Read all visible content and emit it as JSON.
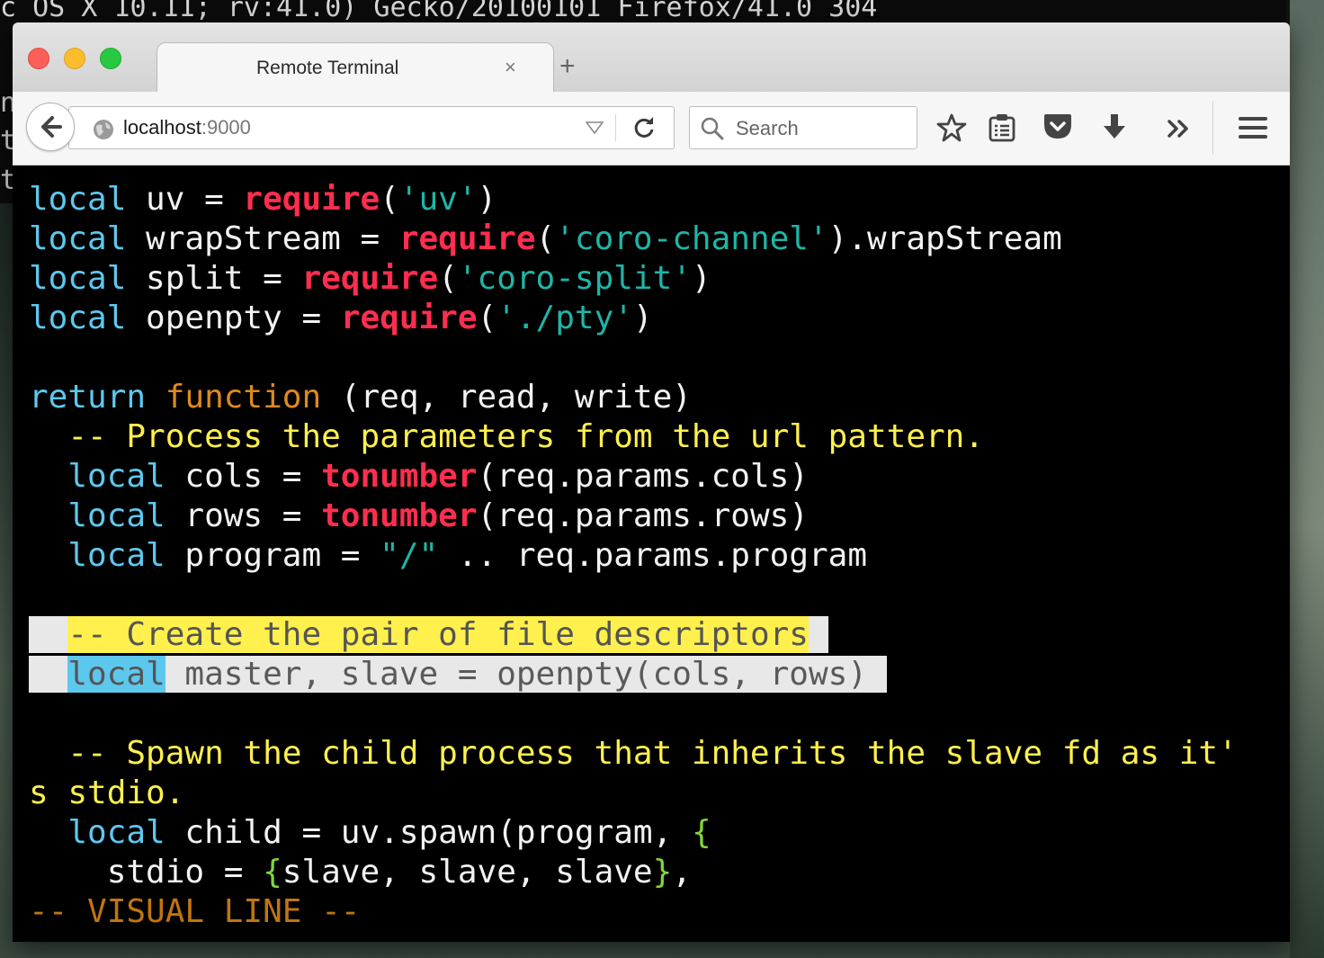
{
  "desktop": {
    "top_text": "c OS X 10.11; rv:41.0) Gecko/20100101 Firefox/41.0 304",
    "left_chars": [
      "n",
      "t",
      "t"
    ]
  },
  "tab": {
    "title": "Remote Terminal",
    "close_glyph": "×",
    "new_tab_glyph": "+"
  },
  "url": {
    "host": "localhost",
    "port": ":9000"
  },
  "search": {
    "placeholder": "Search"
  },
  "toolbar_icons": [
    "back-icon",
    "globe-icon",
    "dropdown-icon",
    "reload-icon",
    "search-icon",
    "bookmark-star-icon",
    "reading-list-icon",
    "pocket-icon",
    "download-icon",
    "overflow-icon",
    "menu-icon"
  ],
  "terminal": {
    "l1": [
      "local",
      " uv = ",
      "require",
      "(",
      "'uv'",
      ")"
    ],
    "l2": [
      "local",
      " wrapStream = ",
      "require",
      "(",
      "'coro-channel'",
      ").wrapStream"
    ],
    "l3": [
      "local",
      " split = ",
      "require",
      "(",
      "'coro-split'",
      ")"
    ],
    "l4": [
      "local",
      " openpty = ",
      "require",
      "(",
      "'./pty'",
      ")"
    ],
    "l6": [
      "return",
      " ",
      "function",
      " (req, read, write)"
    ],
    "l7": "  -- Process the parameters from the url pattern.",
    "l8": [
      "  ",
      "local",
      " cols = ",
      "tonumber",
      "(req.params.cols)"
    ],
    "l9": [
      "  ",
      "local",
      " rows = ",
      "tonumber",
      "(req.params.rows)"
    ],
    "l10": [
      "  ",
      "local",
      " program = ",
      "\"/\"",
      " .. req.params.program"
    ],
    "l12": [
      "  ",
      "-- Create the pair of file descriptors",
      " "
    ],
    "l13": [
      "  ",
      "local",
      " master, slave = openpty(cols, rows) "
    ],
    "l15": "  -- Spawn the child process that inherits the slave fd as it'",
    "l16": "s stdio.",
    "l17": [
      "  ",
      "local",
      " child = uv.spawn(program, ",
      "{"
    ],
    "l18": [
      "    stdio = ",
      "{",
      "slave, slave, slave",
      "}",
      ","
    ],
    "status": "-- VISUAL LINE --"
  },
  "colors": {
    "keyword": "#5dc8ee",
    "require": "#ff2e4e",
    "string": "#1fb5a8",
    "function": "#e08a1e",
    "comment": "#fff04d",
    "brace": "#7fd63a",
    "status": "#c07510"
  }
}
